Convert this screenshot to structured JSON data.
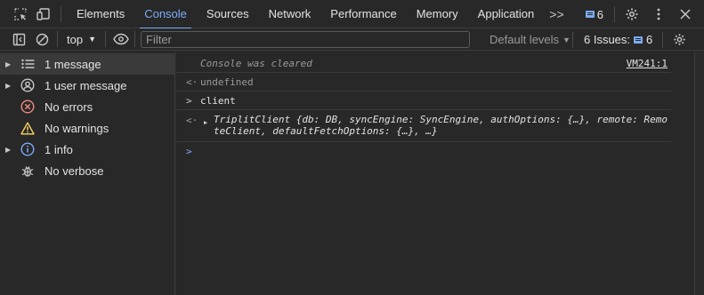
{
  "tabs": [
    "Elements",
    "Console",
    "Sources",
    "Network",
    "Performance",
    "Memory",
    "Application"
  ],
  "active_tab": "Console",
  "tab_more": ">>",
  "header_messages_count": "6",
  "toolbar": {
    "context": "top",
    "filter_placeholder": "Filter",
    "default_levels": "Default levels",
    "issues_label": "6 Issues:",
    "issues_count": "6"
  },
  "sidebar": {
    "items": [
      {
        "label": "1 message",
        "icon": "list-icon"
      },
      {
        "label": "1 user message",
        "icon": "user-icon"
      },
      {
        "label": "No errors",
        "icon": "error-icon"
      },
      {
        "label": "No warnings",
        "icon": "warning-icon"
      },
      {
        "label": "1 info",
        "icon": "info-icon"
      },
      {
        "label": "No verbose",
        "icon": "bug-icon"
      }
    ]
  },
  "console": {
    "cleared_text": "Console was cleared",
    "cleared_source": "VM241:1",
    "undefined_text": "undefined",
    "input_text": "client",
    "object_name": "TriplitClient",
    "object_part1": " {db: DB, syncEngine: SyncEngine, authOptions: {…}, remote: Remo",
    "object_part2": "teClient, defaultFetchOptions: {…}, …}"
  },
  "colors": {
    "accent": "#7cacf8",
    "background": "#282828",
    "error": "#f28b82",
    "warning": "#fdd663"
  }
}
